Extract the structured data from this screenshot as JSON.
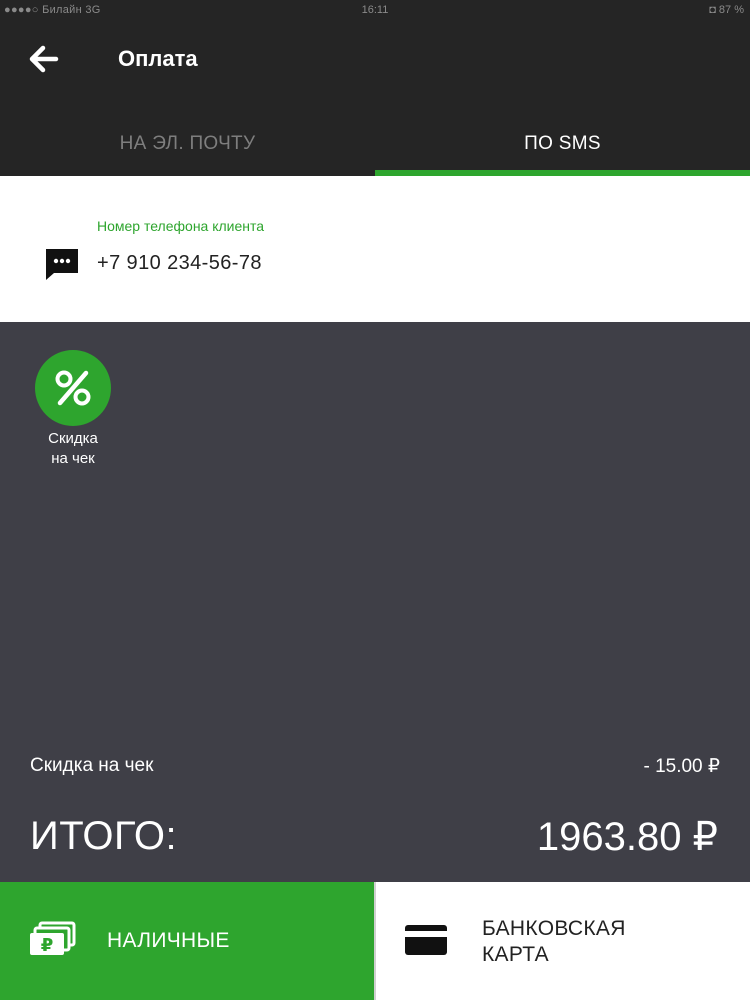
{
  "status_bar": {
    "carrier": "●●●●○ Билайн  3G",
    "time": "16:11",
    "battery": "◘ 87 %"
  },
  "header": {
    "title": "Оплата",
    "back_icon": "arrow-left-icon"
  },
  "tabs": [
    {
      "label": "НА ЭЛ. ПОЧТУ",
      "active": false
    },
    {
      "label": "ПО SMS",
      "active": true
    }
  ],
  "phone": {
    "label": "Номер телефона клиента",
    "value": "+7 910 234-56-78",
    "icon": "sms-icon"
  },
  "discount_button": {
    "label": "Скидка\nна чек",
    "icon": "percent-icon"
  },
  "summary": {
    "discount_label": "Скидка на чек",
    "discount_value": "- 15.00 ₽",
    "total_label": "ИТОГО:",
    "total_value": "1963.80 ₽"
  },
  "payment": {
    "cash_label": "НАЛИЧНЫЕ",
    "card_label": "БАНКОВСКАЯ\nКАРТА"
  },
  "colors": {
    "accent": "#2ea52e",
    "dark": "#252525",
    "body": "#3f3f47"
  }
}
